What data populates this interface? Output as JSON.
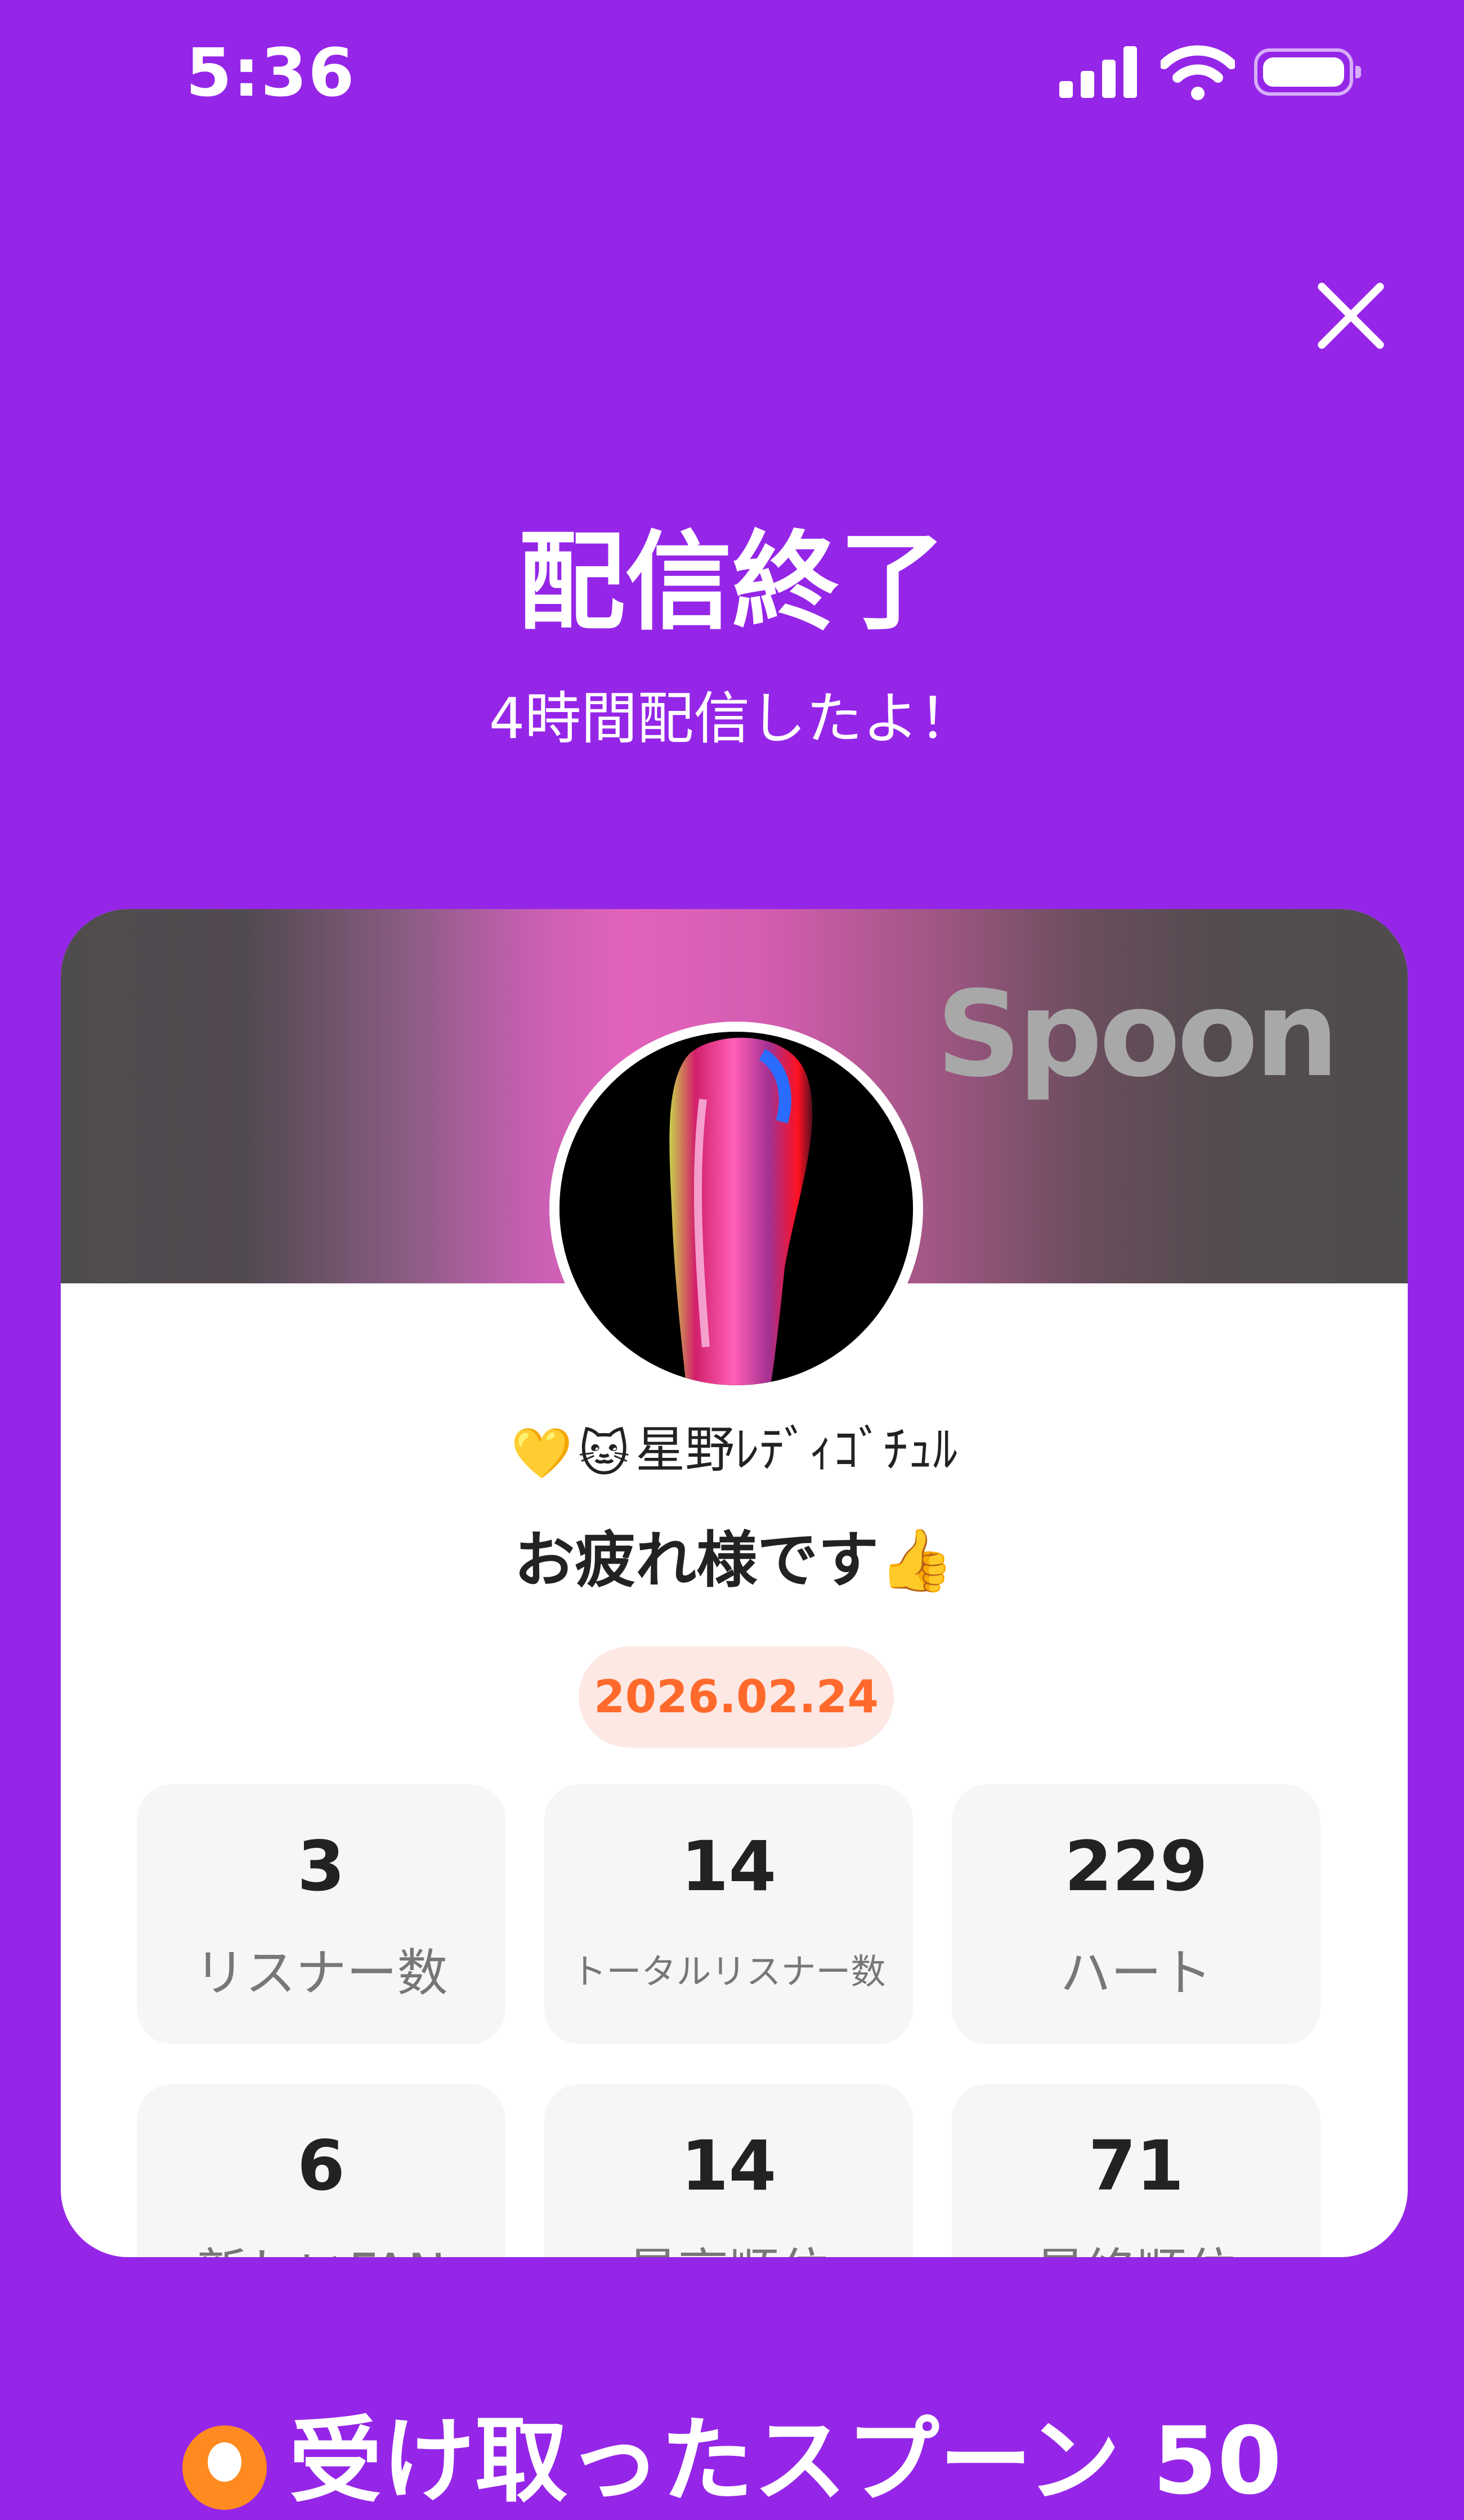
{
  "status_bar": {
    "time": "5:36"
  },
  "header": {
    "title": "配信終了",
    "subtitle": "4時間配信したよ！"
  },
  "card": {
    "brand": "Spoon",
    "user_name": "星野ﾚﾃﾞｨｺﾞﾁｭﾙ",
    "name_emojis": [
      "💛",
      "🐱"
    ],
    "message": "お疲れ様です👍",
    "date": "2026.02.24",
    "stats": [
      {
        "value": "3",
        "label": "リスナー数"
      },
      {
        "value": "14",
        "label": "トータルリスナー数"
      },
      {
        "value": "229",
        "label": "ハート"
      },
      {
        "value": "6",
        "label": "新しいFAN"
      },
      {
        "value": "14",
        "label": "最高順位"
      },
      {
        "value": "71",
        "label": "最終順位"
      }
    ]
  },
  "bottom": {
    "received_spoons": "受け取ったスプーン 50"
  },
  "colors": {
    "background": "#9526E8",
    "date_accent": "#FF6A2C"
  },
  "icons": [
    "close-icon",
    "signal-icon",
    "wifi-icon",
    "battery-icon",
    "spoon-coin-icon"
  ]
}
